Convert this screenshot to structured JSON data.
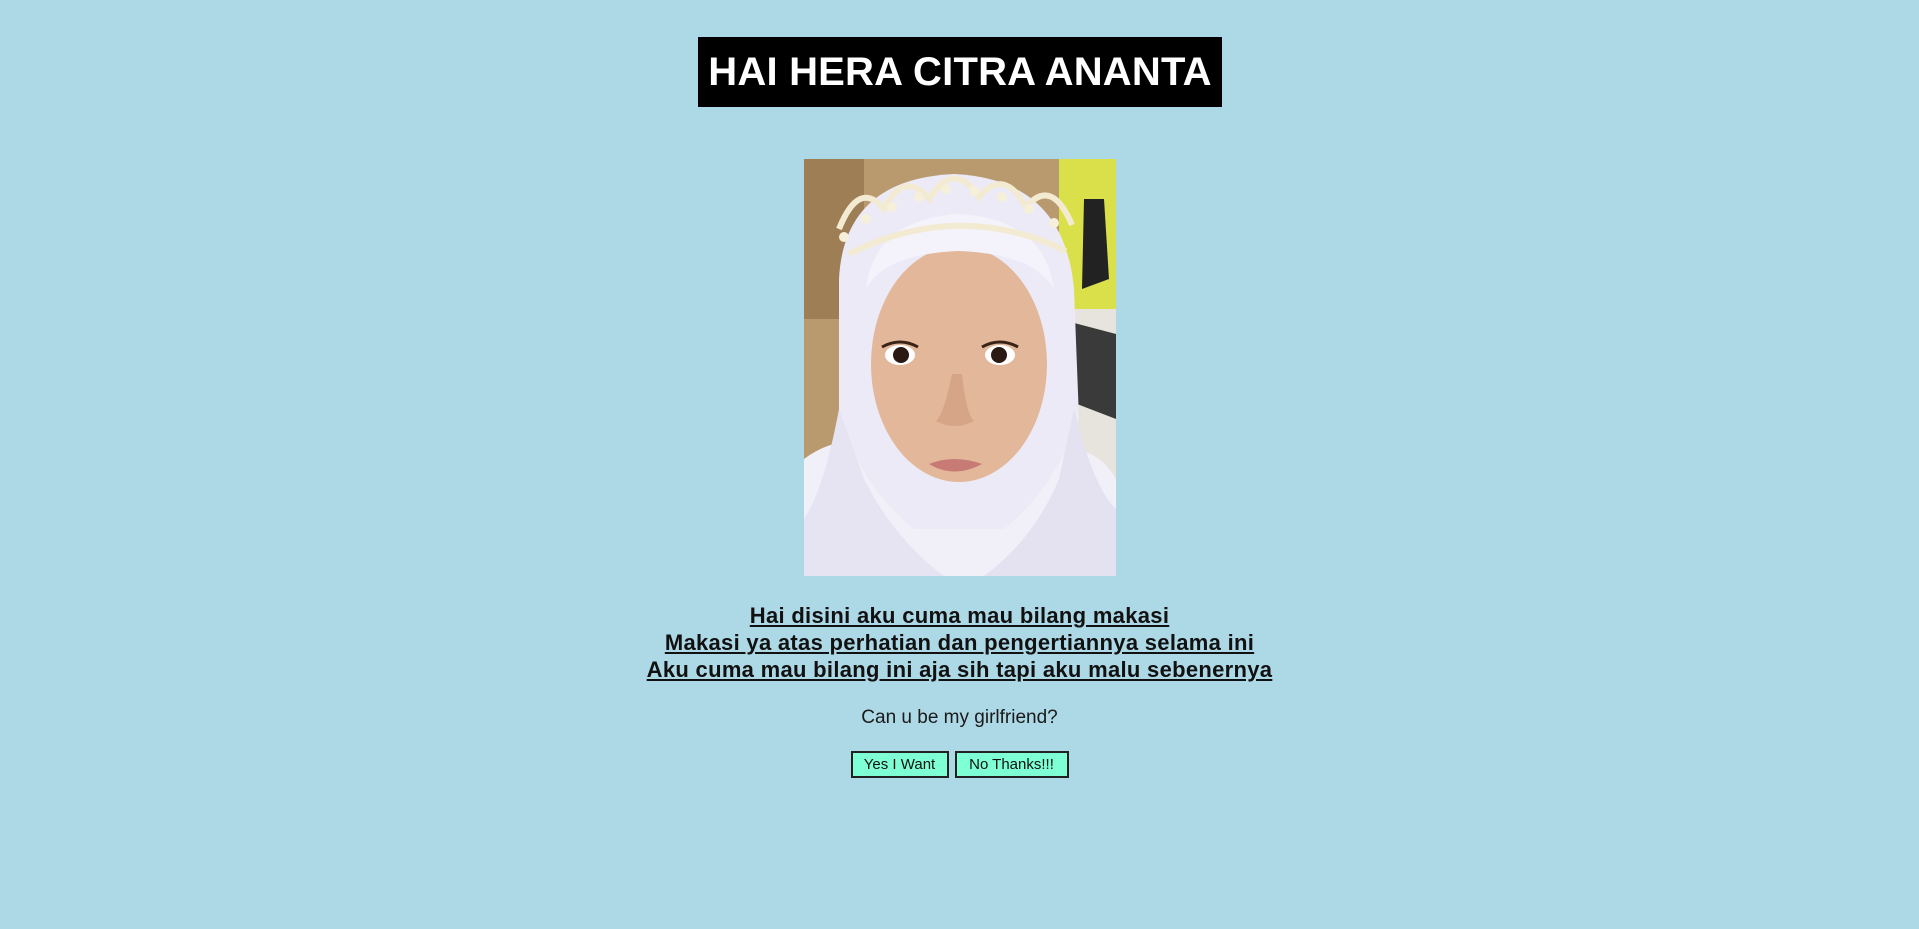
{
  "header": {
    "title": "HAI HERA CITRA ANANTA"
  },
  "photo": {
    "alt": "Portrait photo"
  },
  "message": {
    "lines": [
      "Hai disini aku cuma mau bilang makasi",
      "Makasi ya atas perhatian dan pengertiannya selama ini",
      "Aku cuma mau bilang ini aja sih tapi aku malu sebenernya"
    ]
  },
  "question": "Can u be my girlfriend?",
  "buttons": {
    "yes_label": "Yes I Want",
    "no_label": "No Thanks!!!"
  },
  "colors": {
    "background": "#add8e6",
    "title_background": "#000000",
    "title_text": "#ffffff",
    "button_background": "#7fffd4"
  }
}
